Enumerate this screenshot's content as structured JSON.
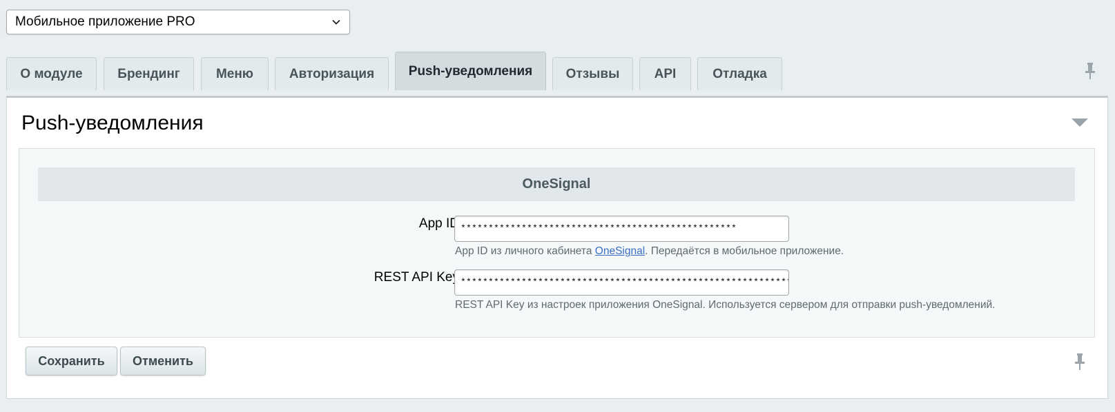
{
  "module_selector": {
    "value": "Мобильное приложение PRO"
  },
  "tabs": [
    {
      "label": "О модуле"
    },
    {
      "label": "Брендинг"
    },
    {
      "label": "Меню"
    },
    {
      "label": "Авторизация"
    },
    {
      "label": "Push-уведомления",
      "active": true
    },
    {
      "label": "Отзывы"
    },
    {
      "label": "API"
    },
    {
      "label": "Отладка"
    }
  ],
  "panel": {
    "title": "Push-уведомления",
    "section_title": "OneSignal",
    "fields": {
      "app_id": {
        "label": "App ID",
        "value": "**************************************************",
        "hint_before": "App ID из личного кабинета ",
        "hint_link": "OneSignal",
        "hint_after": ". Передаётся в мобильное приложение."
      },
      "rest_api_key": {
        "label": "REST API Key",
        "value": "************************************************************************",
        "hint": "REST API Key из настроек приложения OneSignal. Используется сервером для отправки push-уведомлений."
      }
    }
  },
  "buttons": {
    "save": "Сохранить",
    "cancel": "Отменить"
  },
  "icons": {
    "pin": "pin-icon",
    "collapse": "triangle-down-icon",
    "dropdown": "chevron-down-icon"
  },
  "colors": {
    "background": "#e9eef0",
    "link": "#3a6fc4",
    "active_tab": "#d4dcdf"
  }
}
